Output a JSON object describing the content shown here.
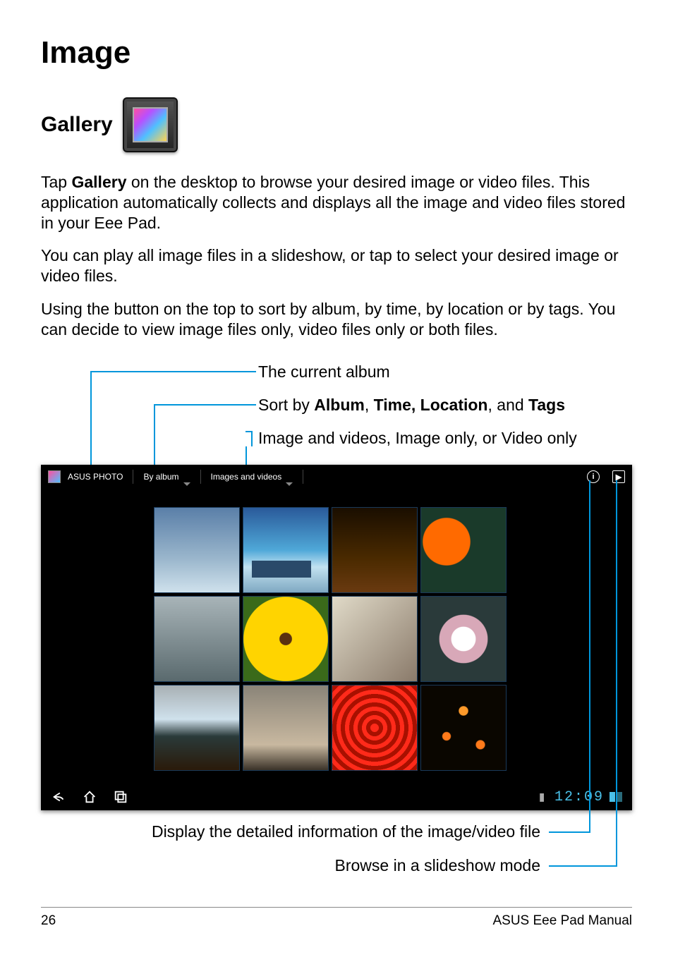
{
  "title": "Image",
  "section": "Gallery",
  "paragraphs": {
    "p1_pre": "Tap ",
    "p1_bold": "Gallery",
    "p1_post": " on the desktop to browse your desired image or video files. This application automatically collects and displays all the image and video files stored in your Eee Pad.",
    "p2": "You can play all image files in a slideshow, or tap to select your desired image or video files.",
    "p3": "Using the button on the top to sort by album, by time, by location or by tags. You can decide to view image files only, video files only or both files."
  },
  "callouts": {
    "current_album": "The current album",
    "sort_pre": "Sort by ",
    "sort_b1": "Album",
    "sort_mid1": ", ",
    "sort_b2": "Time, Location",
    "sort_mid2": ", and ",
    "sort_b3": "Tags",
    "filter": "Image and videos, Image only, or Video only",
    "detail": "Display the detailed information of the image/video file",
    "slideshow": "Browse in a slideshow mode"
  },
  "tablet": {
    "app_name": "ASUS PHOTO",
    "sort_label": "By album",
    "filter_label": "Images and videos",
    "info_glyph": "i",
    "play_glyph": "▶",
    "clock": "12:09"
  },
  "footer": {
    "page": "26",
    "manual": "ASUS Eee Pad Manual"
  }
}
